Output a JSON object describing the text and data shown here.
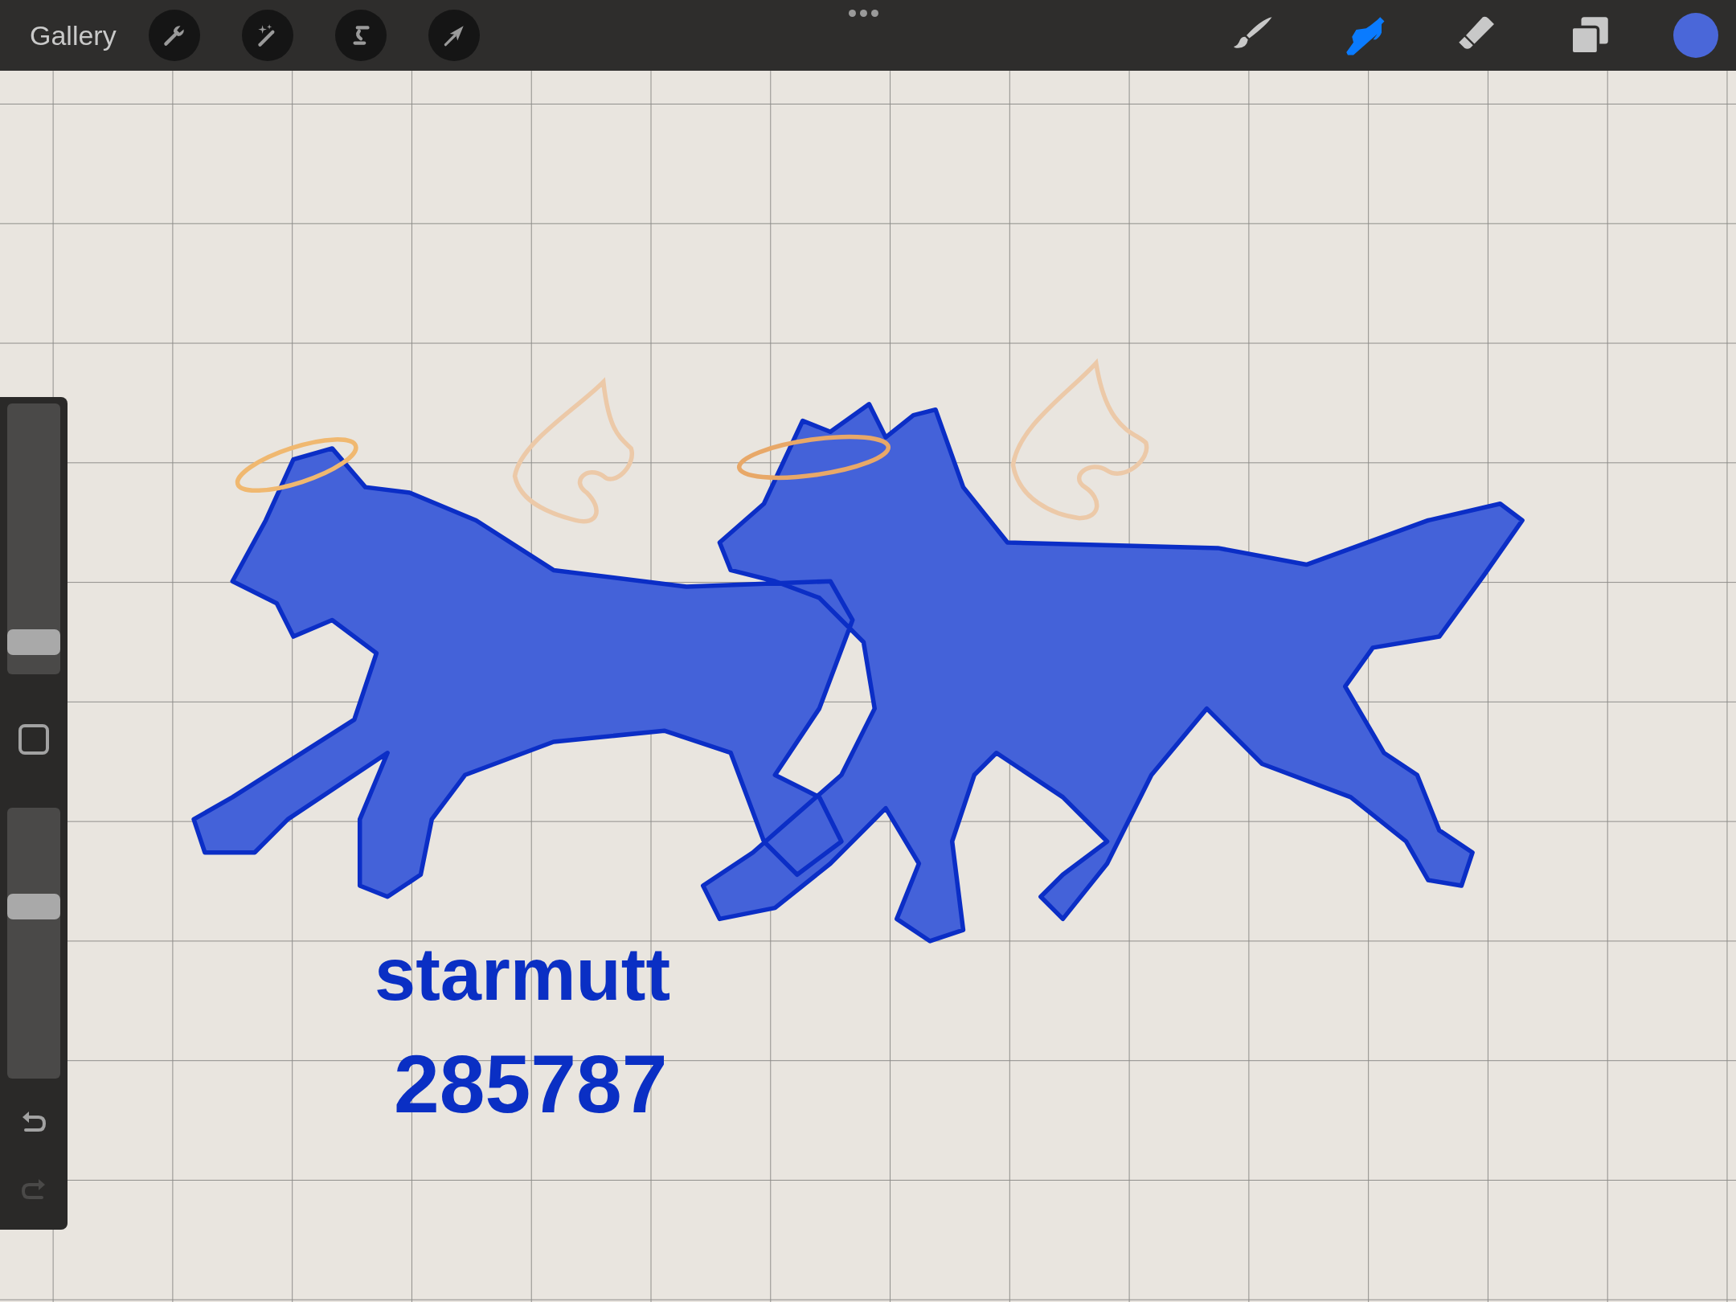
{
  "toolbar": {
    "gallery_label": "Gallery",
    "left_tools": [
      {
        "kind": "wrench"
      },
      {
        "kind": "wand"
      },
      {
        "kind": "selection"
      },
      {
        "kind": "transform"
      }
    ],
    "right_tools": [
      {
        "kind": "brush",
        "selected": false
      },
      {
        "kind": "smudge",
        "selected": true
      },
      {
        "kind": "eraser",
        "selected": false
      },
      {
        "kind": "layers",
        "selected": false
      }
    ],
    "color": "#4a67d9"
  },
  "sidebar": {
    "brush_size": {
      "level": 0.08
    },
    "opacity": {
      "level": 0.65
    },
    "undo": {
      "disabled": false
    },
    "redo": {
      "disabled": true
    }
  },
  "canvas": {
    "texts": [
      "starmutt",
      "285787"
    ]
  }
}
